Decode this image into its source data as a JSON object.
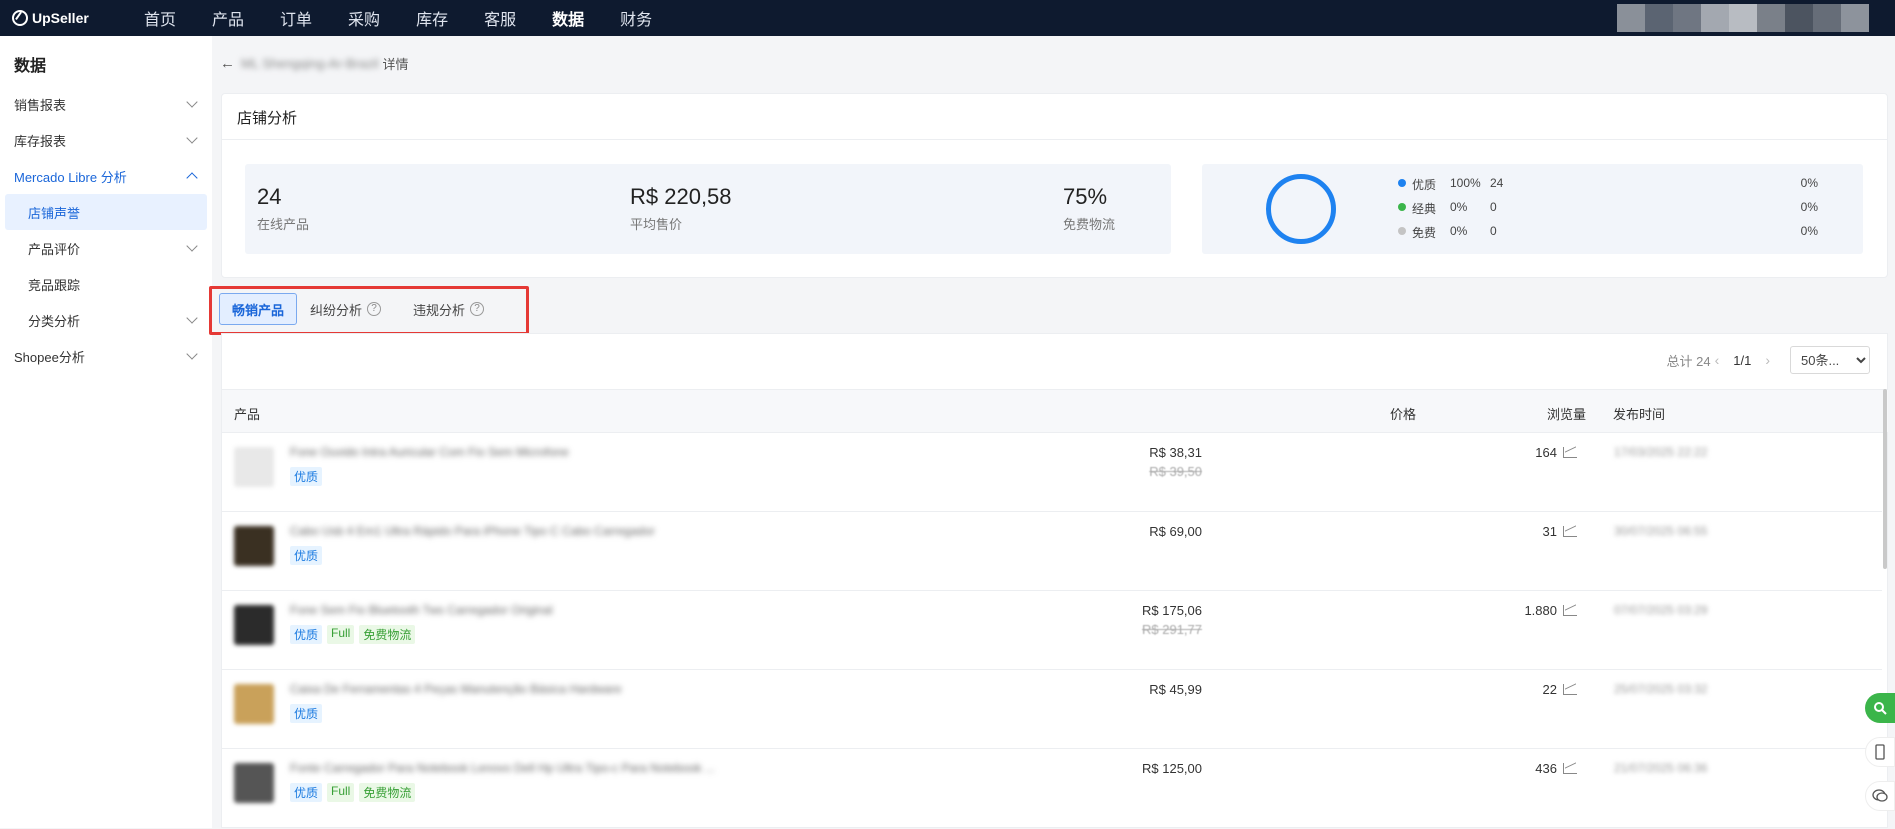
{
  "app": {
    "logo": "UpSeller"
  },
  "nav": {
    "items": [
      "首页",
      "产品",
      "订单",
      "采购",
      "库存",
      "客服",
      "数据",
      "财务"
    ],
    "active": "数据"
  },
  "sidebar": {
    "title": "数据",
    "items": [
      {
        "label": "销售报表"
      },
      {
        "label": "库存报表"
      },
      {
        "label": "Mercado Libre 分析"
      },
      {
        "label": "店铺声誉"
      },
      {
        "label": "产品评价"
      },
      {
        "label": "竞品跟踪"
      },
      {
        "label": "分类分析"
      },
      {
        "label": "Shopee分析"
      }
    ]
  },
  "breadcrumb": {
    "store": "ML Shengqing-Ar-Brazil",
    "detail": "详情"
  },
  "shop": {
    "title": "店铺分析",
    "stats": [
      {
        "value": "24",
        "label": "在线产品"
      },
      {
        "value": "R$ 220,58",
        "label": "平均售价"
      },
      {
        "value": "75%",
        "label": "免费物流"
      }
    ],
    "legend": [
      {
        "name": "优质",
        "pct": "100%",
        "count": "24",
        "rate": "0%",
        "color": "#1e82f0"
      },
      {
        "name": "经典",
        "pct": "0%",
        "count": "0",
        "rate": "0%",
        "color": "#3bb54a"
      },
      {
        "name": "免费",
        "pct": "0%",
        "count": "0",
        "rate": "0%",
        "color": "#c4c4c4"
      }
    ]
  },
  "tabs": {
    "best": "畅销产品",
    "dispute": "纠纷分析",
    "violation": "违规分析",
    "help_glyph": "?"
  },
  "pager": {
    "total": "总计 24",
    "page": "1/1",
    "size": "50条..."
  },
  "table": {
    "headers": {
      "product": "产品",
      "price": "价格",
      "views": "浏览量",
      "published": "发布时间"
    },
    "rows": [
      {
        "name": "Fone Ouvido Intra Auricular Com Fio Sem Microfone",
        "tags": [
          "优质"
        ],
        "price": "R$ 38,31",
        "old_price": "R$ 39,50",
        "views": "164",
        "date": "17/03/2025 22:22"
      },
      {
        "name": "Cabo Usb 4 Em1 Ultra Rápido Para iPhone Tipo C Cabo Carregador",
        "tags": [
          "优质"
        ],
        "price": "R$ 69,00",
        "old_price": "",
        "views": "31",
        "date": "30/07/2025 06:55"
      },
      {
        "name": "Fone Sem Fio Bluetooth Tws Carregador Original",
        "tags": [
          "优质",
          "Full",
          "免费物流"
        ],
        "price": "R$ 175,06",
        "old_price": "R$ 291,77",
        "views": "1.880",
        "date": "07/07/2025 03:29"
      },
      {
        "name": "Caixa De Ferramentas 4 Peças Manutenção Básica Hardware",
        "tags": [
          "优质"
        ],
        "price": "R$ 45,99",
        "old_price": "",
        "views": "22",
        "date": "25/07/2025 03:32"
      },
      {
        "name": "Fonte Carregador Para Notebook Lenovo Dell Hp Ultra Tipo-c Para Notebook ...",
        "tags": [
          "优质",
          "Full",
          "免费物流"
        ],
        "price": "R$ 125,00",
        "old_price": "",
        "views": "436",
        "date": "21/07/2025 06:36"
      }
    ]
  },
  "colors": {
    "primary": "#1a66d9",
    "topbar": "#0e1a2f",
    "highlight": "#e53935"
  }
}
